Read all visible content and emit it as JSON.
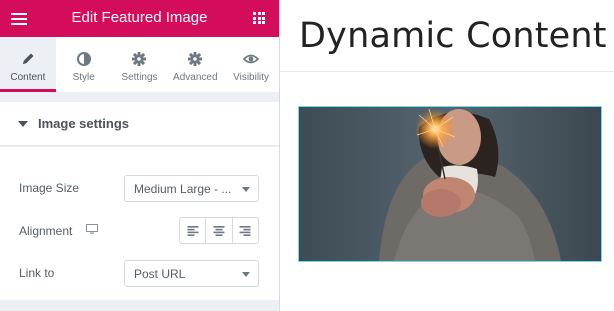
{
  "panel": {
    "title": "Edit Featured Image",
    "tabs": [
      {
        "label": "Content",
        "icon": "pencil-icon",
        "active": true
      },
      {
        "label": "Style",
        "icon": "half-circle-icon",
        "active": false
      },
      {
        "label": "Settings",
        "icon": "gear-icon",
        "active": false
      },
      {
        "label": "Advanced",
        "icon": "gear-icon",
        "active": false
      },
      {
        "label": "Visibility",
        "icon": "eye-icon",
        "active": false
      }
    ],
    "section": {
      "title": "Image settings"
    },
    "fields": {
      "image_size": {
        "label": "Image Size",
        "value": "Medium Large - ..."
      },
      "alignment": {
        "label": "Alignment",
        "options": [
          "align-left",
          "align-center",
          "align-right"
        ]
      },
      "link_to": {
        "label": "Link to",
        "value": "Post URL"
      }
    }
  },
  "content": {
    "title": "Dynamic Content"
  },
  "colors": {
    "brand": "#d30c5c",
    "selection_outline": "#71d7f7"
  }
}
